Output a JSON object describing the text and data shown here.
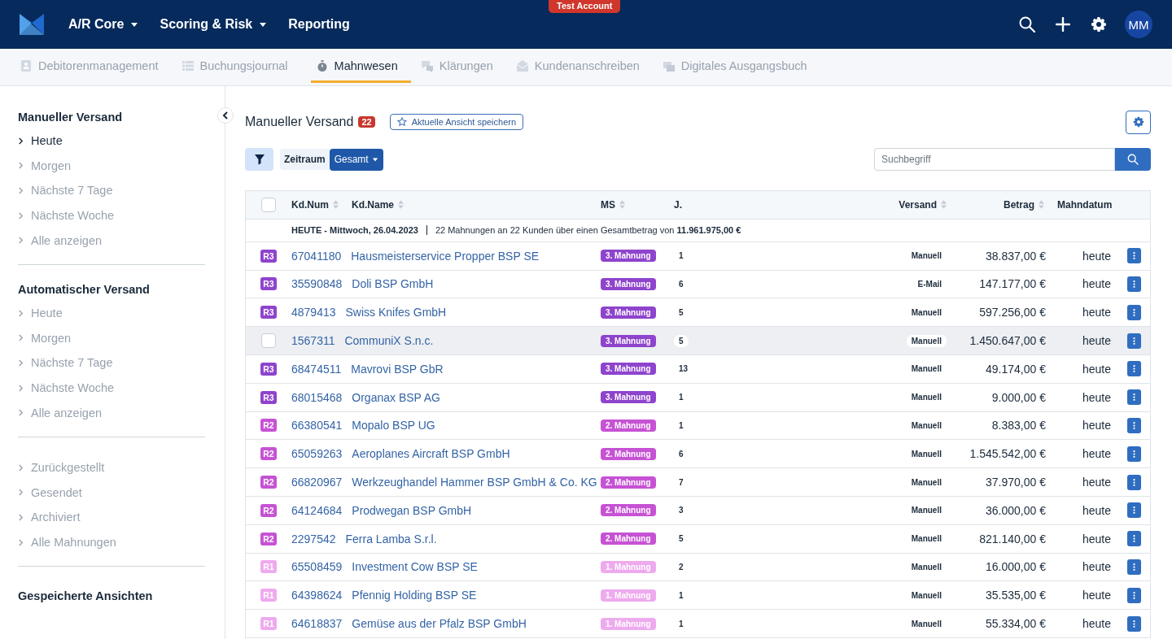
{
  "topbar": {
    "menus": [
      {
        "label": "A/R Core",
        "dropdown": true
      },
      {
        "label": "Scoring & Risk",
        "dropdown": true
      },
      {
        "label": "Reporting",
        "dropdown": false
      }
    ],
    "env_badge": "Test Account",
    "avatar": "MM"
  },
  "subnav": [
    {
      "label": "Debitorenmanagement",
      "selected": false
    },
    {
      "label": "Buchungsjournal",
      "selected": false
    },
    {
      "label": "Mahnwesen",
      "selected": true
    },
    {
      "label": "Klärungen",
      "selected": false
    },
    {
      "label": "Kundenanschreiben",
      "selected": false
    },
    {
      "label": "Digitales Ausgangsbuch",
      "selected": false
    }
  ],
  "sidebar": {
    "sections": [
      {
        "title": "Manueller Versand",
        "items": [
          {
            "label": "Heute",
            "selected": true
          },
          {
            "label": "Morgen",
            "selected": false
          },
          {
            "label": "Nächste 7 Tage",
            "selected": false
          },
          {
            "label": "Nächste Woche",
            "selected": false
          },
          {
            "label": "Alle anzeigen",
            "selected": false
          }
        ]
      },
      {
        "title": "Automatischer Versand",
        "items": [
          {
            "label": "Heute",
            "selected": false
          },
          {
            "label": "Morgen",
            "selected": false
          },
          {
            "label": "Nächste 7 Tage",
            "selected": false
          },
          {
            "label": "Nächste Woche",
            "selected": false
          },
          {
            "label": "Alle anzeigen",
            "selected": false
          }
        ]
      },
      {
        "items": [
          {
            "label": "Zurückgestellt",
            "selected": false
          },
          {
            "label": "Gesendet",
            "selected": false
          },
          {
            "label": "Archiviert",
            "selected": false
          },
          {
            "label": "Alle Mahnungen",
            "selected": false
          }
        ]
      },
      {
        "title": "Gespeicherte Ansichten"
      }
    ]
  },
  "main": {
    "title": "Manueller Versand",
    "count": "22",
    "save_view": "Aktuelle Ansicht speichern",
    "filter_label": "Zeitraum",
    "filter_value": "Gesamt",
    "search_placeholder": "Suchbegriff"
  },
  "table": {
    "select_all_checked": false,
    "columns": [
      {
        "label": "Kd.Num",
        "sortable": true
      },
      {
        "label": "Kd.Name",
        "sortable": true
      },
      {
        "label": "MS",
        "sortable": true
      },
      {
        "label": "J.",
        "sortable": false
      },
      {
        "label": "Versand",
        "sortable": true
      },
      {
        "label": "Betrag",
        "sortable": true
      },
      {
        "label": "Mahndatum",
        "sortable": false
      }
    ],
    "group": {
      "date": "**HEUTE - Mittwoch, 26.04.2023**",
      "summary": "22 Mahnungen an 22 Kunden über einen Gesamtbetrag von **11.961.975,00 €**"
    },
    "rows": [
      {
        "stage": "R3",
        "color": "#8e44cc",
        "num": "67041180",
        "name": "Hausmeisterservice Propper BSP SE",
        "ms": "3. Mahnung",
        "j": "1",
        "versand": "Manuell",
        "betrag": "38.837,00 €",
        "datum": "heute",
        "hovered": false
      },
      {
        "stage": "R3",
        "color": "#8e44cc",
        "num": "35590848",
        "name": "Doli BSP GmbH",
        "ms": "3. Mahnung",
        "j": "6",
        "versand": "E-Mail",
        "betrag": "147.177,00 €",
        "datum": "heute",
        "hovered": false
      },
      {
        "stage": "R3",
        "color": "#8e44cc",
        "num": "4879413",
        "name": "Swiss Knifes GmbH",
        "ms": "3. Mahnung",
        "j": "5",
        "versand": "Manuell",
        "betrag": "597.256,00 €",
        "datum": "heute",
        "hovered": false
      },
      {
        "color": "#8e44cc",
        "num": "1567311",
        "name": "CommuniX S.n.c.",
        "ms": "3. Mahnung",
        "j": "5",
        "versand": "Manuell",
        "betrag": "1.450.647,00 €",
        "datum": "heute",
        "hovered": true
      },
      {
        "stage": "R3",
        "color": "#8e44cc",
        "num": "68474511",
        "name": "Mavrovi BSP GbR",
        "ms": "3. Mahnung",
        "j": "13",
        "versand": "Manuell",
        "betrag": "49.174,00 €",
        "datum": "heute",
        "hovered": false
      },
      {
        "stage": "R3",
        "color": "#8e44cc",
        "num": "68015468",
        "name": "Organax BSP AG",
        "ms": "3. Mahnung",
        "j": "1",
        "versand": "Manuell",
        "betrag": "9.000,00 €",
        "datum": "heute",
        "hovered": false
      },
      {
        "stage": "R2",
        "color": "#c652d4",
        "num": "66380541",
        "name": "Mopalo BSP UG",
        "ms": "2. Mahnung",
        "j": "1",
        "versand": "Manuell",
        "betrag": "8.383,00 €",
        "datum": "heute",
        "hovered": false
      },
      {
        "stage": "R2",
        "color": "#c652d4",
        "num": "65059263",
        "name": "Aeroplanes Aircraft BSP GmbH",
        "ms": "2. Mahnung",
        "j": "6",
        "versand": "Manuell",
        "betrag": "1.545.542,00 €",
        "datum": "heute",
        "hovered": false
      },
      {
        "stage": "R2",
        "color": "#c652d4",
        "num": "66820967",
        "name": "Werkzeughandel Hammer BSP GmbH & Co. KG",
        "ms": "2. Mahnung",
        "j": "7",
        "versand": "Manuell",
        "betrag": "37.970,00 €",
        "datum": "heute",
        "hovered": false
      },
      {
        "stage": "R2",
        "color": "#c652d4",
        "num": "64124684",
        "name": "Prodwegan BSP GmbH",
        "ms": "2. Mahnung",
        "j": "3",
        "versand": "Manuell",
        "betrag": "36.000,00 €",
        "datum": "heute",
        "hovered": false
      },
      {
        "stage": "R2",
        "color": "#c652d4",
        "num": "2297542",
        "name": "Ferra Lamba S.r.l.",
        "ms": "2. Mahnung",
        "j": "5",
        "versand": "Manuell",
        "betrag": "821.140,00 €",
        "datum": "heute",
        "hovered": false
      },
      {
        "stage": "R1",
        "color": "#eeaaee",
        "num": "65508459",
        "name": "Investment Cow BSP SE",
        "ms": "1. Mahnung",
        "j": "2",
        "versand": "Manuell",
        "betrag": "16.000,00 €",
        "datum": "heute",
        "hovered": false
      },
      {
        "stage": "R1",
        "color": "#eeaaee",
        "num": "64398624",
        "name": "Pfennig Holding BSP SE",
        "ms": "1. Mahnung",
        "j": "1",
        "versand": "Manuell",
        "betrag": "35.535,00 €",
        "datum": "heute",
        "hovered": false
      },
      {
        "stage": "R1",
        "color": "#eeaaee",
        "num": "64618837",
        "name": "Gemüse aus der Pfalz BSP GmbH",
        "ms": "1. Mahnung",
        "j": "1",
        "versand": "Manuell",
        "betrag": "55.334,00 €",
        "datum": "heute",
        "hovered": false
      }
    ]
  }
}
